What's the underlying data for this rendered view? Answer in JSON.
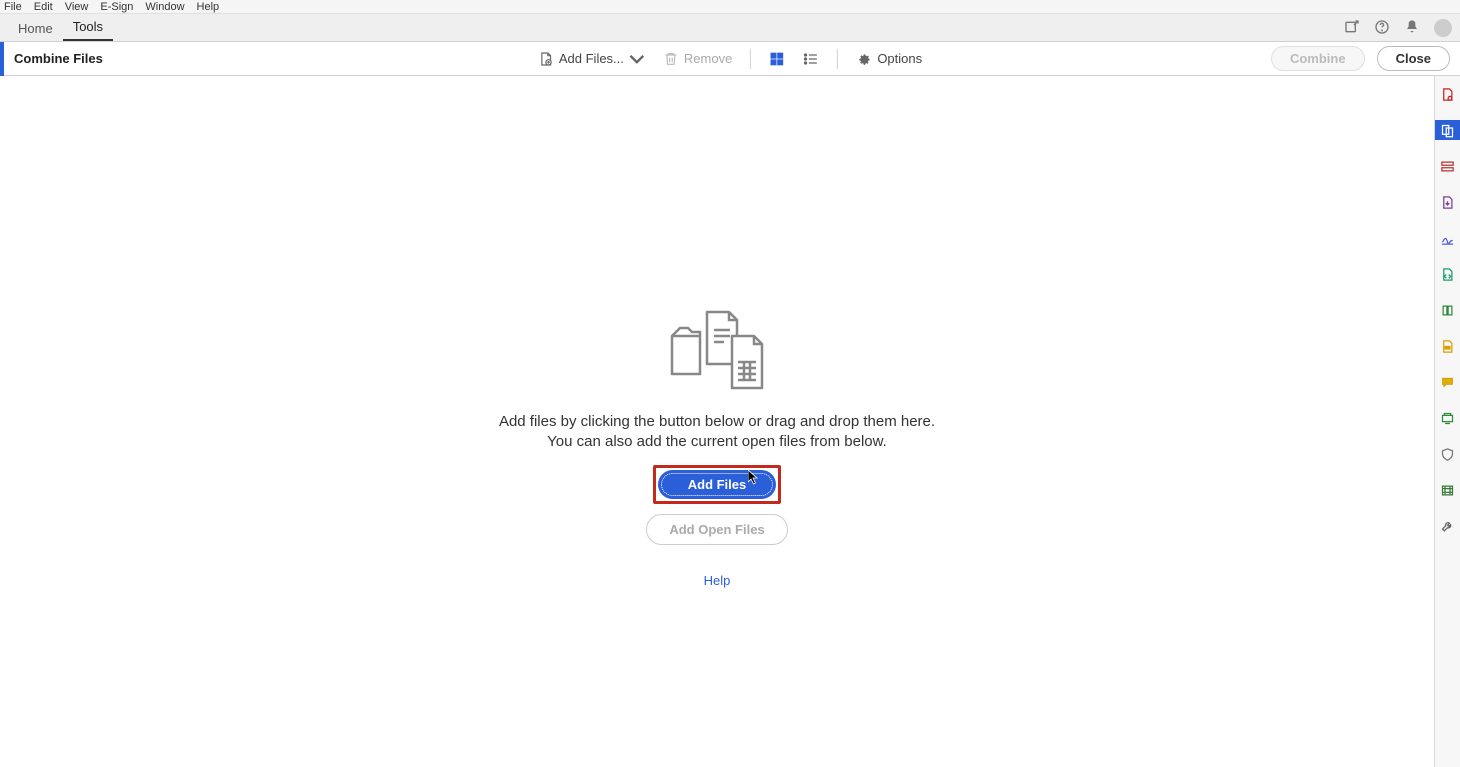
{
  "menubar": {
    "items": [
      "File",
      "Edit",
      "View",
      "E-Sign",
      "Window",
      "Help"
    ]
  },
  "tabs": {
    "home": "Home",
    "tools": "Tools"
  },
  "toolbar": {
    "title": "Combine Files",
    "addFiles": "Add Files...",
    "remove": "Remove",
    "options": "Options",
    "combine": "Combine",
    "close": "Close"
  },
  "empty": {
    "line1": "Add files by clicking the button below or drag and drop them here.",
    "line2": "You can also add the current open files from below.",
    "addFilesBtn": "Add Files",
    "addOpenFilesBtn": "Add Open Files",
    "help": "Help"
  }
}
